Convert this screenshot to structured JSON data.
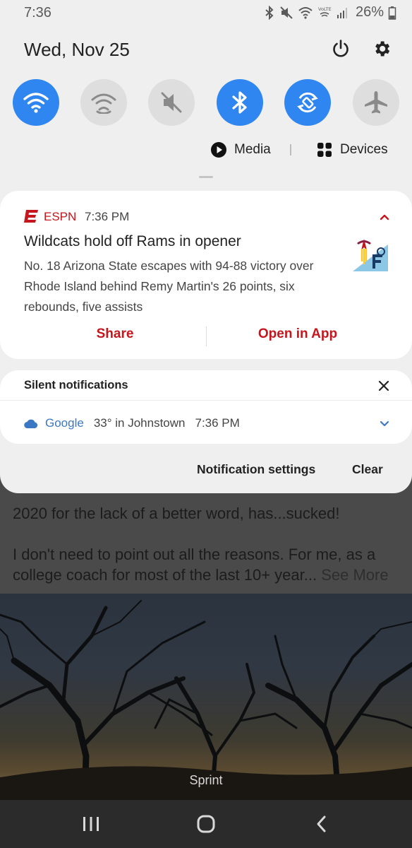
{
  "status_bar": {
    "time": "7:36",
    "battery_percent": "26%",
    "icons": [
      "bluetooth-icon",
      "mute-icon",
      "wifi-icon",
      "volte-icon",
      "signal-icon",
      "battery-icon"
    ]
  },
  "header": {
    "date": "Wed, Nov 25",
    "power_icon": "power-icon",
    "settings_icon": "gear-icon"
  },
  "quick_tiles": [
    {
      "name": "Wi-Fi",
      "icon": "wifi-icon",
      "state": "on"
    },
    {
      "name": "Mobile Hotspot",
      "icon": "hotspot-icon",
      "state": "off"
    },
    {
      "name": "Mute",
      "icon": "mute-icon",
      "state": "off"
    },
    {
      "name": "Bluetooth",
      "icon": "bluetooth-icon",
      "state": "on"
    },
    {
      "name": "Auto rotate",
      "icon": "rotate-icon",
      "state": "on"
    },
    {
      "name": "Airplane mode",
      "icon": "airplane-icon",
      "state": "off"
    }
  ],
  "media_row": {
    "media_label": "Media",
    "devices_label": "Devices"
  },
  "espn_notification": {
    "app_name": "ESPN",
    "time": "7:36 PM",
    "title": "Wildcats hold off Rams in opener",
    "body": "No. 18 Arizona State escapes with 94-88 victory over Rhode Island behind Remy Martin's 26 points, six rebounds, five assists",
    "actions": {
      "share": "Share",
      "open": "Open in App"
    }
  },
  "silent_notifications": {
    "title": "Silent notifications",
    "google": {
      "app": "Google",
      "text": "33° in Johnstown",
      "time": "7:36 PM"
    }
  },
  "footer": {
    "settings_label": "Notification settings",
    "clear_label": "Clear"
  },
  "background_app": {
    "post_line1": "2020 for the lack of a better word, has...sucked!",
    "post_line2": "I don't need to point out all the reasons. For me, as a college coach for most of the last 10+ year...",
    "see_more": "See More",
    "carrier": "Sprint"
  },
  "colors": {
    "accent_blue": "#2f86f0",
    "espn_red": "#c4161c",
    "google_blue": "#3b78c4"
  }
}
